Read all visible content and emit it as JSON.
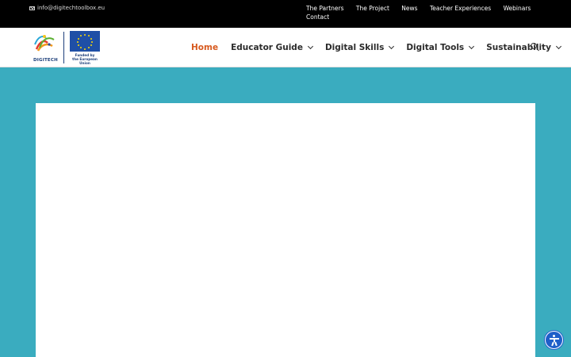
{
  "topbar": {
    "email": "info@digitechtoolbox.eu",
    "links": [
      "The Partners",
      "The Project",
      "News",
      "Teacher Experiences",
      "Webinars",
      "Contact"
    ]
  },
  "logo": {
    "brand": "DIGITECH",
    "eu_text_line1": "Funded by",
    "eu_text_line2": "the European Union"
  },
  "nav": {
    "items": [
      {
        "label": "Home",
        "active": true,
        "dropdown": false
      },
      {
        "label": "Educator Guide",
        "active": false,
        "dropdown": true
      },
      {
        "label": "Digital Skills",
        "active": false,
        "dropdown": true
      },
      {
        "label": "Digital Tools",
        "active": false,
        "dropdown": true
      },
      {
        "label": "Sustainability",
        "active": false,
        "dropdown": true
      }
    ],
    "search_icon": "search-icon"
  },
  "colors": {
    "accent": "#d75a1f",
    "background": "#3aacbf",
    "topbar": "#000000",
    "eu_blue": "#1f4fa6",
    "a11y_blue": "#1f5fc9"
  },
  "icons": {
    "mail": "envelope-icon",
    "accessibility": "accessibility-icon"
  }
}
